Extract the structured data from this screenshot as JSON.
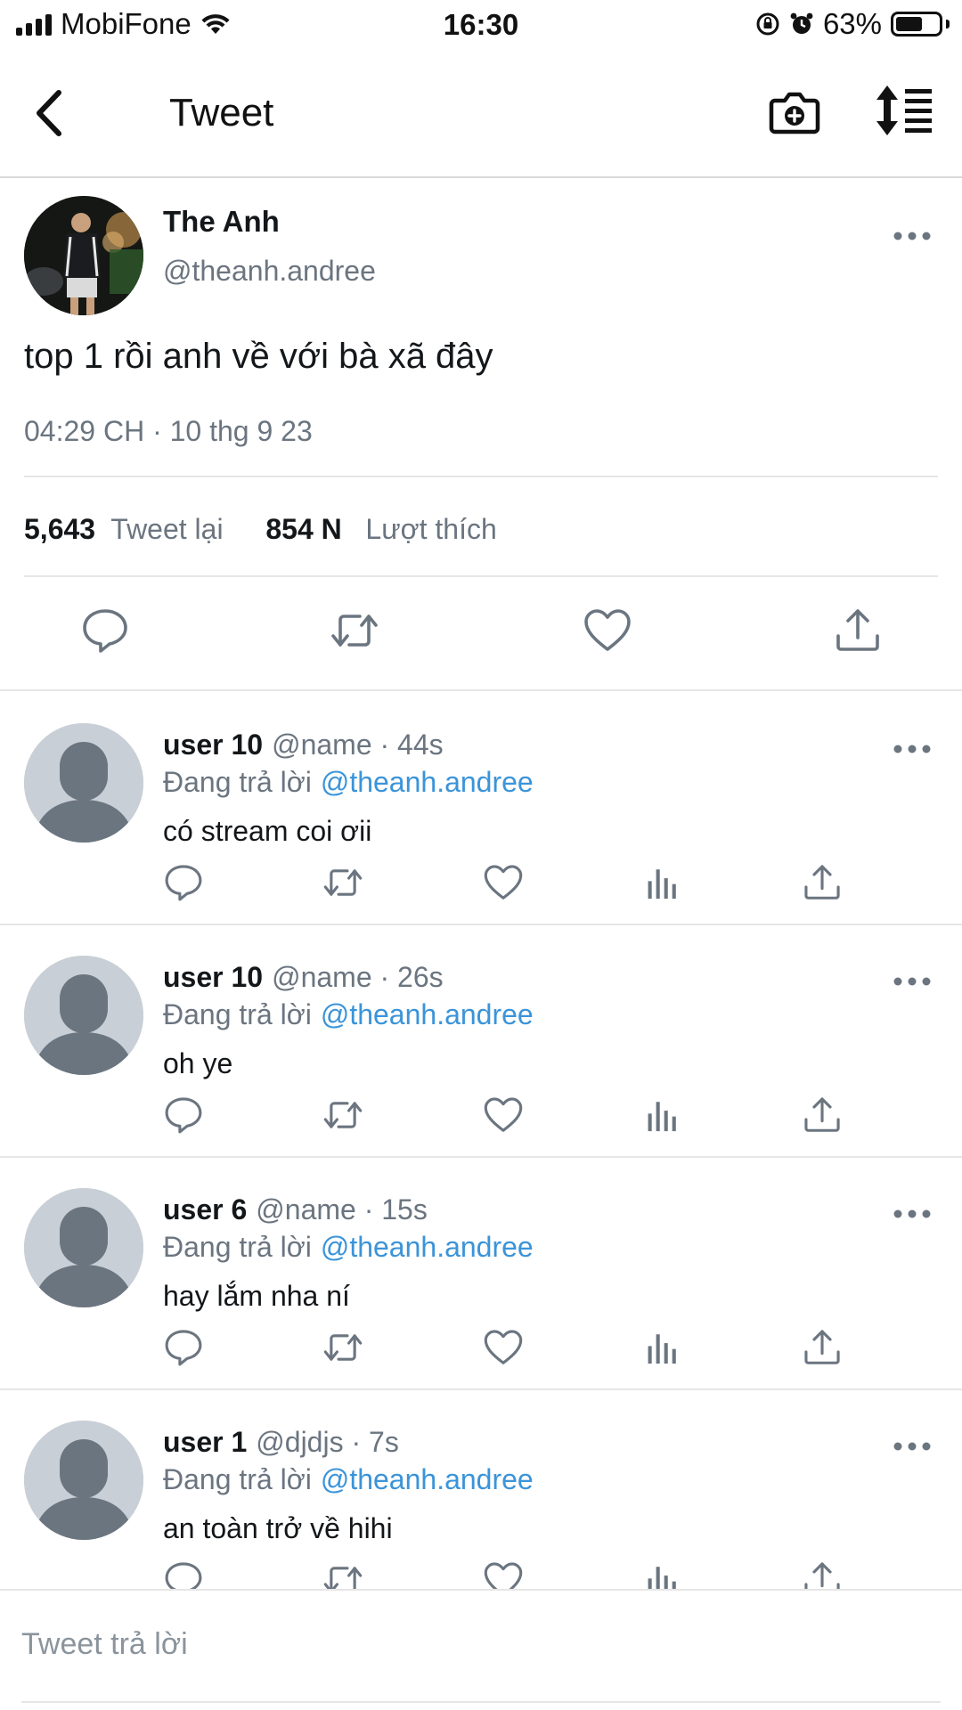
{
  "status_bar": {
    "carrier": "MobiFone",
    "time": "16:30",
    "battery_percent": "63%",
    "battery_level": 0.63
  },
  "header": {
    "title": "Tweet",
    "icons": [
      "back-arrow-icon",
      "camera-icon",
      "sort-icon"
    ]
  },
  "tweet": {
    "author_name": "The Anh",
    "author_handle": "@theanh.andree",
    "text": "top 1 rồi anh về với bà xã đây",
    "timestamp": "04:29 CH · 10 thg 9 23",
    "retweet_count": "5,643",
    "retweet_label": "Tweet lại",
    "like_count": "854 N",
    "like_label": "Lượt thích",
    "actions": [
      "reply-icon",
      "retweet-icon",
      "like-icon",
      "share-icon"
    ]
  },
  "replies": [
    {
      "name": "user 10",
      "meta": "@name · 44s",
      "replying_label": "Đang trả lời",
      "replying_to": "@theanh.andree",
      "text": "có stream coi ơii"
    },
    {
      "name": "user 10",
      "meta": "@name · 26s",
      "replying_label": "Đang trả lời",
      "replying_to": "@theanh.andree",
      "text": "oh ye"
    },
    {
      "name": "user 6",
      "meta": "@name · 15s",
      "replying_label": "Đang trả lời",
      "replying_to": "@theanh.andree",
      "text": "hay lắm nha ní"
    },
    {
      "name": "user 1",
      "meta": "@djdjs · 7s",
      "replying_label": "Đang trả lời",
      "replying_to": "@theanh.andree",
      "text": "an toàn trở về hihi"
    }
  ],
  "reply_actions": [
    "reply-icon",
    "retweet-icon",
    "like-icon",
    "analytics-icon",
    "share-icon"
  ],
  "composer": {
    "placeholder": "Tweet trả lời"
  },
  "colors": {
    "mention": "#3b94d9",
    "secondary_text": "#6b7580",
    "icon_gray": "#6b7580",
    "avatar_placeholder": "#c9cfd6",
    "avatar_silhouette": "#6b7580"
  }
}
